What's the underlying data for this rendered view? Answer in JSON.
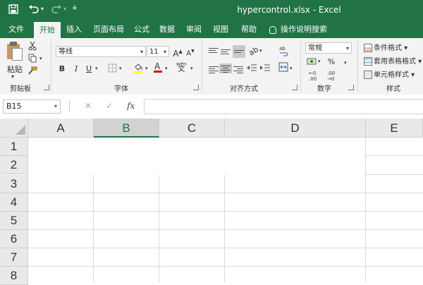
{
  "titlebar": {
    "title": "hypercontrol.xlsx  -  Excel",
    "icons": [
      "save-icon",
      "undo-icon",
      "redo-icon",
      "customize-qat-icon"
    ]
  },
  "tabs": [
    "文件",
    "开始",
    "插入",
    "页面布局",
    "公式",
    "数据",
    "审阅",
    "视图",
    "帮助"
  ],
  "active_tab": "开始",
  "tell_me": "操作说明搜索",
  "ribbon": {
    "clipboard": {
      "paste": "粘贴",
      "label": "剪贴板"
    },
    "font": {
      "name": "等线",
      "size": "11",
      "grow": "A",
      "shrink": "A",
      "bold": "B",
      "italic": "I",
      "underline": "U",
      "wen": "wén",
      "wen_char": "文",
      "label": "字体"
    },
    "alignment": {
      "label": "对齐方式"
    },
    "number": {
      "format": "常规",
      "percent": "%",
      "comma": ",",
      "inc": ".00",
      "dec": ".00",
      "label": "数字"
    },
    "styles": {
      "conditional": "条件格式",
      "table": "套用表格格式",
      "cell": "单元格样式",
      "label": "样式"
    }
  },
  "formula_bar": {
    "name_box": "B15",
    "fx": "fx",
    "value": ""
  },
  "grid": {
    "columns": [
      "A",
      "B",
      "C",
      "D",
      "E"
    ],
    "selected_column": "B",
    "rows": [
      "1",
      "2",
      "3",
      "4",
      "5",
      "6",
      "7",
      "8"
    ]
  },
  "colors": {
    "brand": "#217346",
    "ribbon_bg": "#f3f3f3",
    "header_bg": "#e9e9e9"
  }
}
